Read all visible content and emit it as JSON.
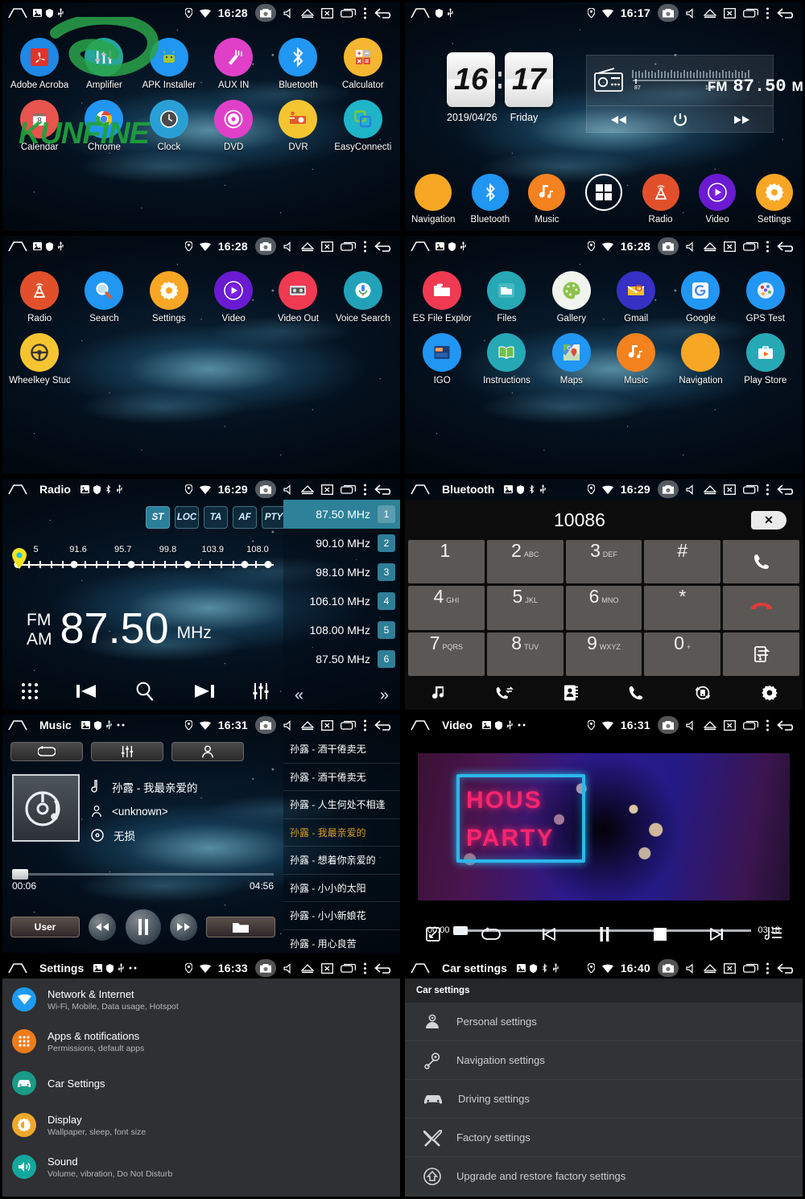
{
  "statusbar": {
    "icons": [
      "home-icon",
      "sd-card-icon",
      "shield-icon",
      "usb-icon",
      "location-icon",
      "wifi-icon",
      "camera-icon",
      "mute-icon",
      "eject-icon",
      "close-window-icon",
      "recents-icon",
      "overflow-icon",
      "back-icon"
    ],
    "times": {
      "p1": "16:28",
      "p2": "16:17",
      "p3": "16:28",
      "p4": "16:28",
      "p5": "16:29",
      "p6": "16:29",
      "p7": "16:31",
      "p8": "16:31",
      "p9": "16:33",
      "p10": "16:40"
    },
    "titles": {
      "p5": "Radio",
      "p6": "Bluetooth",
      "p7": "Music",
      "p8": "Video",
      "p9": "Settings",
      "p10": "Car settings"
    }
  },
  "watermark": {
    "text": "KUNFINE",
    "color": "#1fa23c"
  },
  "apps_page1": [
    {
      "label": "Adobe Acroba",
      "icon": "adobe-acrobat-icon",
      "color": "#1e88e5"
    },
    {
      "label": "Amplifier",
      "icon": "amplifier-icon",
      "color": "#26a69a"
    },
    {
      "label": "APK Installer",
      "icon": "apk-installer-icon",
      "color": "#2196f3"
    },
    {
      "label": "AUX IN",
      "icon": "aux-in-icon",
      "color": "#e040c8"
    },
    {
      "label": "Bluetooth",
      "icon": "bluetooth-icon",
      "color": "#2196f3"
    },
    {
      "label": "Calculator",
      "icon": "calculator-icon",
      "color": "#f5b731"
    },
    {
      "label": "Calendar",
      "icon": "calendar-icon",
      "color": "#e8544e"
    },
    {
      "label": "Chrome",
      "icon": "chrome-icon",
      "color": "#2196f3"
    },
    {
      "label": "Clock",
      "icon": "clock-icon",
      "color": "#2a9fd6"
    },
    {
      "label": "DVD",
      "icon": "dvd-icon",
      "color": "#e040c8"
    },
    {
      "label": "DVR",
      "icon": "dvr-icon",
      "color": "#f5c531"
    },
    {
      "label": "EasyConnecti",
      "icon": "easyconnection-icon",
      "color": "#1fb5c8"
    }
  ],
  "apps_page2": [
    {
      "label": "Radio",
      "icon": "radio-icon",
      "color": "#e2502b"
    },
    {
      "label": "Search",
      "icon": "search-icon",
      "color": "#2196f3"
    },
    {
      "label": "Settings",
      "icon": "settings-gear-icon",
      "color": "#f7a724"
    },
    {
      "label": "Video",
      "icon": "video-icon",
      "color": "#6a1bd1"
    },
    {
      "label": "Video Out",
      "icon": "video-out-icon",
      "color": "#ef3a52"
    },
    {
      "label": "Voice Search",
      "icon": "voice-search-icon",
      "color": "#22a2b8"
    },
    {
      "label": "Wheelkey Stud",
      "icon": "wheelkey-icon",
      "color": "#f5c531"
    }
  ],
  "apps_page3": [
    {
      "label": "ES File Explor",
      "icon": "es-file-explorer-icon",
      "color": "#ef3a52"
    },
    {
      "label": "Files",
      "icon": "files-icon",
      "color": "#26a8b5"
    },
    {
      "label": "Gallery",
      "icon": "gallery-icon",
      "color": "#f1f3ef"
    },
    {
      "label": "Gmail",
      "icon": "gmail-icon",
      "color": "#3730c4"
    },
    {
      "label": "Google",
      "icon": "google-icon",
      "color": "#2196f3"
    },
    {
      "label": "GPS Test",
      "icon": "gps-test-icon",
      "color": "#2196f3"
    },
    {
      "label": "IGO",
      "icon": "igo-icon",
      "color": "#2196f3"
    },
    {
      "label": "Instructions",
      "icon": "instructions-icon",
      "color": "#26a8b5"
    },
    {
      "label": "Maps",
      "icon": "maps-icon",
      "color": "#2196f3"
    },
    {
      "label": "Music",
      "icon": "music-icon",
      "color": "#f4821f"
    },
    {
      "label": "Navigation",
      "icon": "navigation-icon",
      "color": "#f7a724"
    },
    {
      "label": "Play Store",
      "icon": "play-store-icon",
      "color": "#26a8b5"
    }
  ],
  "home": {
    "clock": {
      "hour": "16",
      "minute": "17",
      "date": "2019/04/26",
      "weekday": "Friday"
    },
    "radio_widget": {
      "band": "FM",
      "freq": "87.50",
      "unit": "MHz",
      "scale_min": "87",
      "scale_max": "108"
    },
    "dock": [
      {
        "label": "Navigation",
        "icon": "navigation-icon",
        "color": "#f7a724"
      },
      {
        "label": "Bluetooth",
        "icon": "bluetooth-icon",
        "color": "#2196f3"
      },
      {
        "label": "Music",
        "icon": "music-icon",
        "color": "#f4821f"
      },
      {
        "label": "",
        "icon": "all-apps-icon",
        "color": "transparent"
      },
      {
        "label": "Radio",
        "icon": "radio-icon",
        "color": "#e2502b"
      },
      {
        "label": "Video",
        "icon": "video-icon",
        "color": "#6a1bd1"
      },
      {
        "label": "Settings",
        "icon": "settings-gear-icon",
        "color": "#f7a724"
      }
    ]
  },
  "radio": {
    "band_buttons": [
      {
        "label": "ST",
        "active": true
      },
      {
        "label": "LOC",
        "active": false
      },
      {
        "label": "TA",
        "active": false
      },
      {
        "label": "AF",
        "active": false
      },
      {
        "label": "PTY",
        "active": false
      }
    ],
    "scale_labels": [
      "5",
      "91.6",
      "95.7",
      "99.8",
      "103.9",
      "108.0"
    ],
    "band_fm": "FM",
    "band_am": "AM",
    "frequency": "87.50",
    "unit": "MHz",
    "presets": [
      {
        "freq": "87.50 MHz",
        "num": "1",
        "selected": true
      },
      {
        "freq": "90.10 MHz",
        "num": "2",
        "selected": false
      },
      {
        "freq": "98.10 MHz",
        "num": "3",
        "selected": false
      },
      {
        "freq": "106.10 MHz",
        "num": "4",
        "selected": false
      },
      {
        "freq": "108.00 MHz",
        "num": "5",
        "selected": false
      },
      {
        "freq": "87.50 MHz",
        "num": "6",
        "selected": false
      }
    ],
    "prev_page": "«",
    "next_page": "»",
    "controls": [
      "keypad-icon",
      "previous-icon",
      "scan-search-icon",
      "next-icon",
      "equalizer-icon"
    ]
  },
  "bluetooth": {
    "number": "10086",
    "delete_label": "✕",
    "keys": [
      {
        "d": "1",
        "s": ""
      },
      {
        "d": "2",
        "s": "ABC"
      },
      {
        "d": "3",
        "s": "DEF"
      },
      {
        "d": "#",
        "s": ""
      },
      {
        "d": "",
        "s": "",
        "icon": "call-icon"
      },
      {
        "d": "4",
        "s": "GHI"
      },
      {
        "d": "5",
        "s": "JKL"
      },
      {
        "d": "6",
        "s": "MNO"
      },
      {
        "d": "*",
        "s": ""
      },
      {
        "d": "",
        "s": "",
        "icon": "hangup-icon"
      },
      {
        "d": "7",
        "s": "PQRS"
      },
      {
        "d": "8",
        "s": "TUV"
      },
      {
        "d": "9",
        "s": "WXYZ"
      },
      {
        "d": "0",
        "s": "+"
      },
      {
        "d": "",
        "s": "",
        "icon": "transfer-audio-icon"
      }
    ],
    "bottom_bar": [
      "bt-music-icon",
      "call-log-icon",
      "contacts-icon",
      "dialpad-phone-icon",
      "sync-contacts-icon",
      "bt-settings-icon"
    ]
  },
  "music": {
    "top_buttons": [
      "repeat-icon",
      "equalizer-icon",
      "artist-icon"
    ],
    "title": "孙露 - 我最亲爱的",
    "artist": "<unknown>",
    "album": "无损",
    "time_current": "00:06",
    "time_total": "04:56",
    "user_label": "User",
    "controls": [
      "rewind-icon",
      "pause-icon",
      "fast-forward-icon",
      "folder-icon"
    ],
    "playlist": [
      {
        "text": "孙露 - 酒干倦卖无",
        "current": false
      },
      {
        "text": "孙露 - 酒干倦卖无",
        "current": false
      },
      {
        "text": "孙露 - 人生何处不相逢",
        "current": false
      },
      {
        "text": "孙露 - 我最亲爱的",
        "current": true
      },
      {
        "text": "孙露 - 想着你亲爱的",
        "current": false
      },
      {
        "text": "孙露 - 小小的太阳",
        "current": false
      },
      {
        "text": "孙露 - 小小新娘花",
        "current": false
      },
      {
        "text": "孙露 - 用心良苦",
        "current": false
      }
    ]
  },
  "video": {
    "neon_line1": "HOUS",
    "neon_line2": "PARTY",
    "time_current": "00:00",
    "time_total": "03:18",
    "controls": [
      "fullscreen-icon",
      "repeat-icon",
      "previous-icon",
      "pause-icon",
      "stop-icon",
      "next-icon",
      "playlist-icon"
    ]
  },
  "settings": {
    "rows": [
      {
        "title": "Network & Internet",
        "sub": "Wi-Fi, Mobile, Data usage, Hotspot",
        "icon": "wifi-icon",
        "color": "#1d9bf0"
      },
      {
        "title": "Apps & notifications",
        "sub": "Permissions, default apps",
        "icon": "apps-icon",
        "color": "#ef7c1a"
      },
      {
        "title": "Car Settings",
        "sub": "",
        "icon": "car-icon",
        "color": "#199b87"
      },
      {
        "title": "Display",
        "sub": "Wallpaper, sleep, font size",
        "icon": "brightness-icon",
        "color": "#f0a82c"
      },
      {
        "title": "Sound",
        "sub": "Volume, vibration, Do Not Disturb",
        "icon": "volume-icon",
        "color": "#13a89e"
      }
    ]
  },
  "car_settings": {
    "header": "Car settings",
    "rows": [
      {
        "title": "Personal settings",
        "icon": "person-settings-icon"
      },
      {
        "title": "Navigation settings",
        "icon": "nav-pin-icon"
      },
      {
        "title": "Driving settings",
        "icon": "car-icon"
      },
      {
        "title": "Factory settings",
        "icon": "tools-icon"
      },
      {
        "title": "Upgrade and restore factory settings",
        "icon": "upgrade-icon"
      }
    ]
  }
}
